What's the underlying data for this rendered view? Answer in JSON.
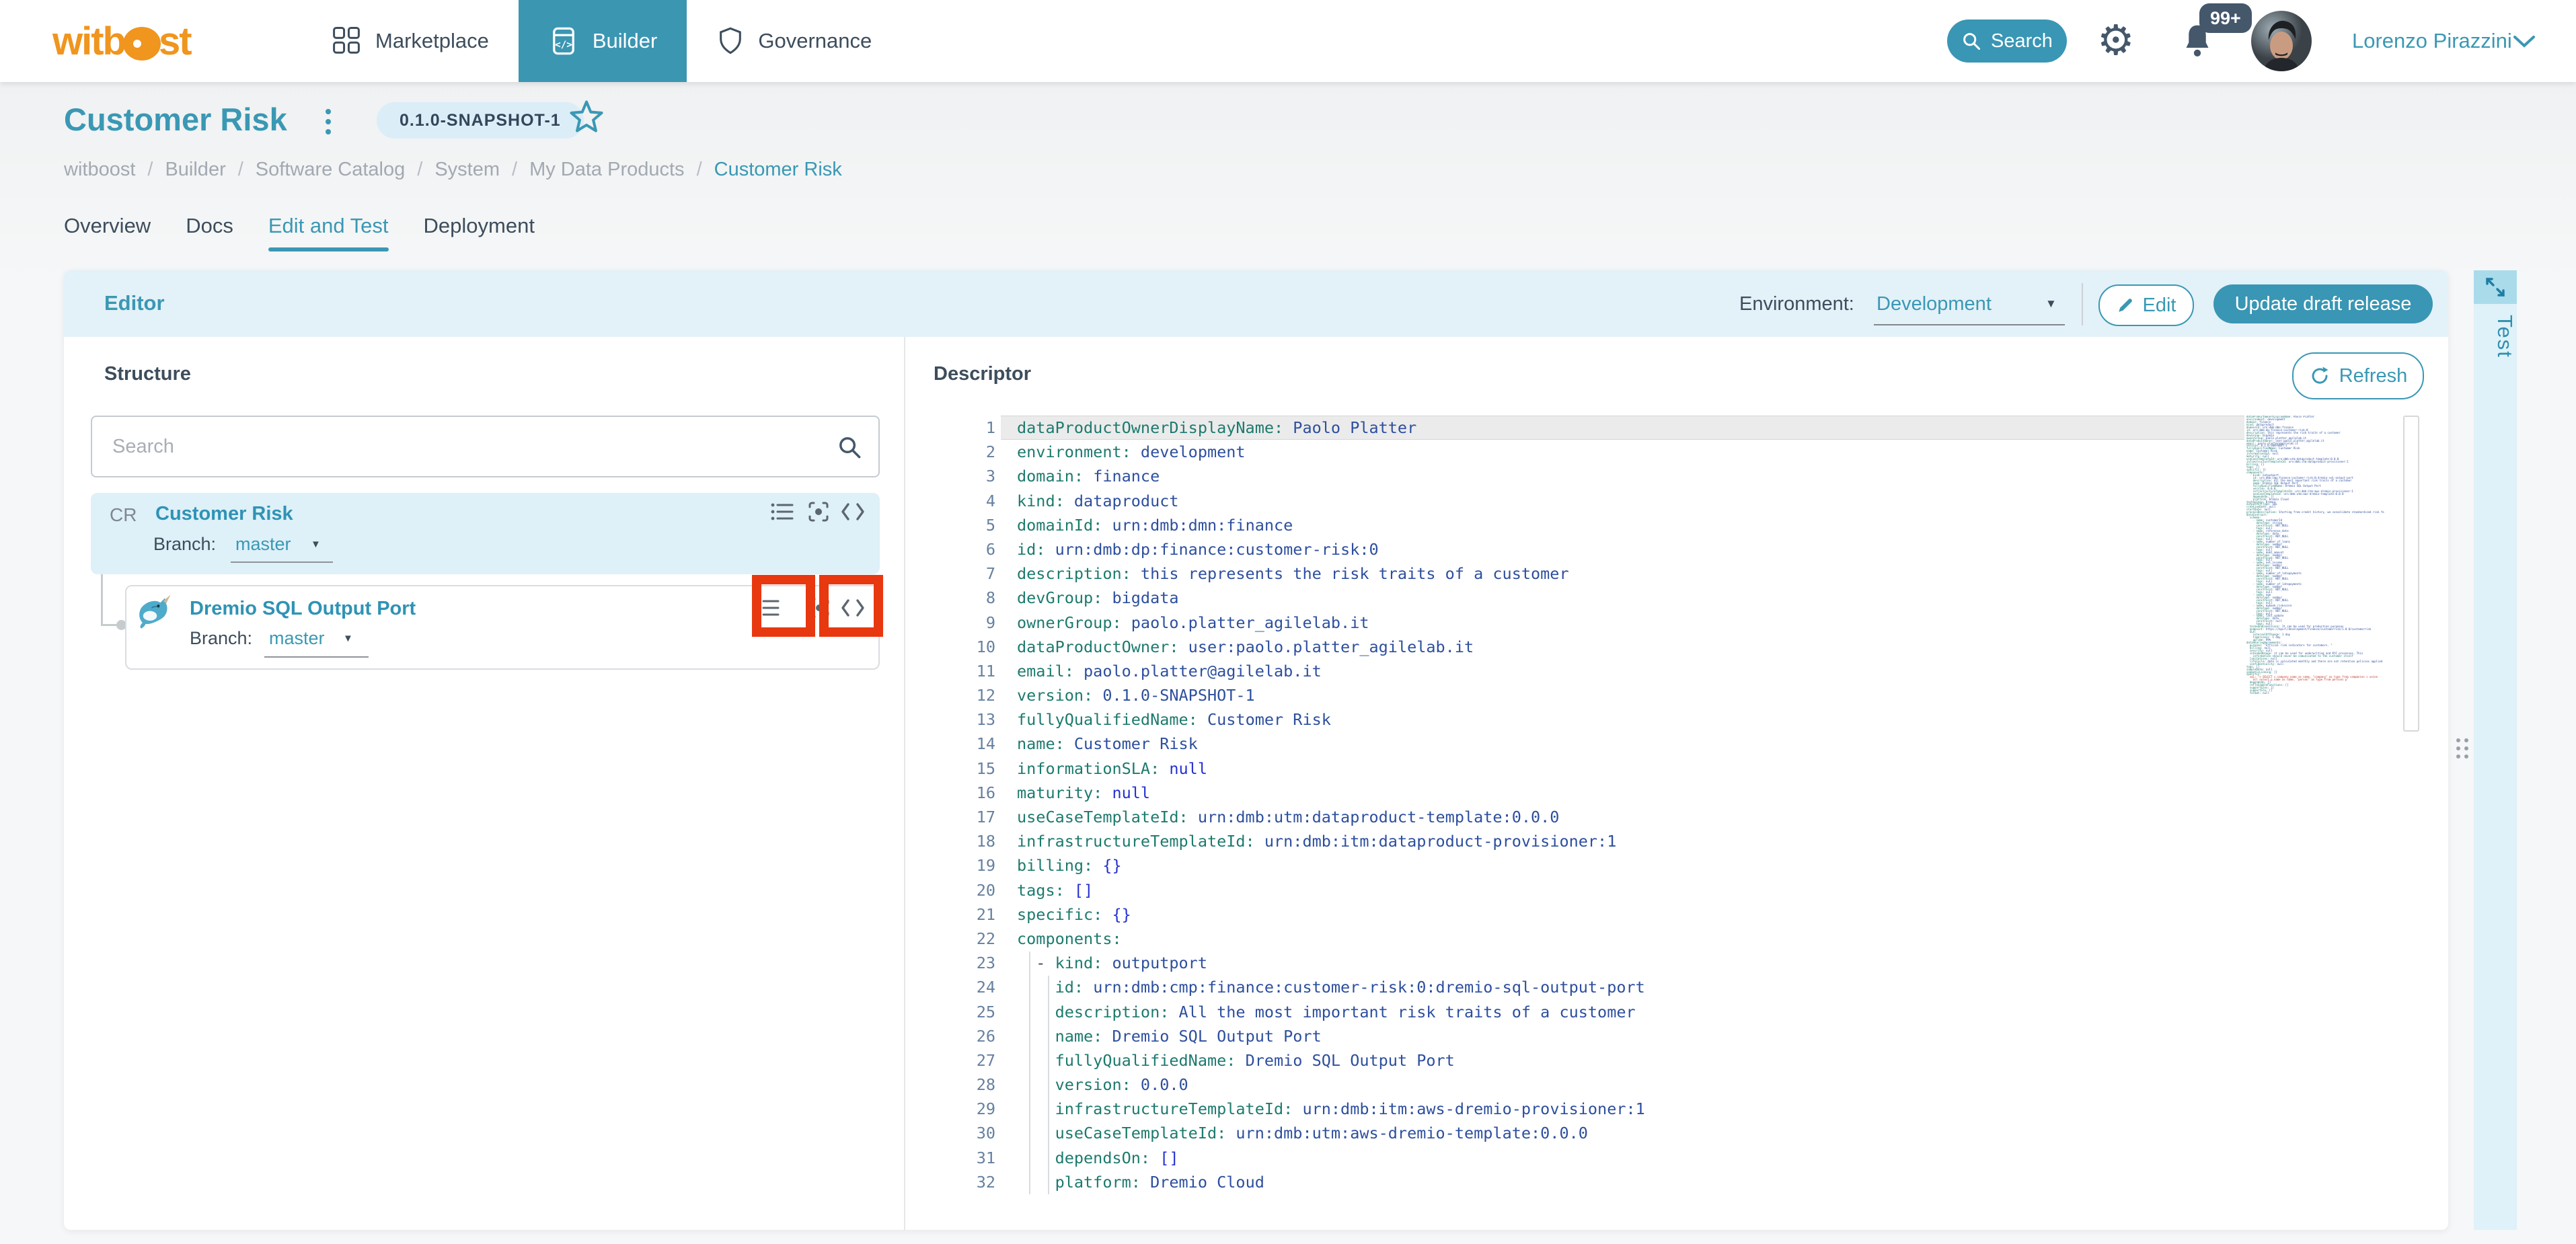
{
  "navbar": {
    "logo": {
      "part1": "witb",
      "part2": "st"
    },
    "items": [
      {
        "label": "Marketplace",
        "active": false
      },
      {
        "label": "Builder",
        "active": true
      },
      {
        "label": "Governance",
        "active": false
      }
    ],
    "search_label": "Search",
    "notifications_badge": "99+",
    "user_name": "Lorenzo Pirazzini"
  },
  "page": {
    "title": "Customer Risk",
    "version_chip": "0.1.0-SNAPSHOT-1",
    "breadcrumb": [
      "witboost",
      "Builder",
      "Software Catalog",
      "System",
      "My Data Products",
      "Customer Risk"
    ],
    "tabs": [
      {
        "label": "Overview",
        "active": false
      },
      {
        "label": "Docs",
        "active": false
      },
      {
        "label": "Edit and Test",
        "active": true
      },
      {
        "label": "Deployment",
        "active": false
      }
    ]
  },
  "editor": {
    "heading": "Editor",
    "environment_label": "Environment:",
    "environment_value": "Development",
    "edit_button": "Edit",
    "update_button": "Update draft release",
    "test_tab": "Test",
    "structure": {
      "heading": "Structure",
      "search_placeholder": "Search",
      "root_node": {
        "badge": "CR",
        "title": "Customer Risk",
        "branch_label": "Branch:",
        "branch": "master"
      },
      "child_node": {
        "title": "Dremio SQL Output Port",
        "branch_label": "Branch:",
        "branch": "master"
      }
    },
    "annotations": {
      "color": "#e8380f",
      "targets": [
        "child-list-icon",
        "child-code-icon"
      ]
    },
    "descriptor": {
      "heading": "Descriptor",
      "refresh_button": "Refresh",
      "yaml": [
        {
          "n": 1,
          "i": 0,
          "k": "dataProductOwnerDisplayName",
          "v": "Paolo Platter",
          "t": "s"
        },
        {
          "n": 2,
          "i": 0,
          "k": "environment",
          "v": "development",
          "t": "s"
        },
        {
          "n": 3,
          "i": 0,
          "k": "domain",
          "v": "finance",
          "t": "s"
        },
        {
          "n": 4,
          "i": 0,
          "k": "kind",
          "v": "dataproduct",
          "t": "s"
        },
        {
          "n": 5,
          "i": 0,
          "k": "domainId",
          "v": "urn:dmb:dmn:finance",
          "t": "s"
        },
        {
          "n": 6,
          "i": 0,
          "k": "id",
          "v": "urn:dmb:dp:finance:customer-risk:0",
          "t": "s"
        },
        {
          "n": 7,
          "i": 0,
          "k": "description",
          "v": "this represents the risk traits of a customer",
          "t": "s"
        },
        {
          "n": 8,
          "i": 0,
          "k": "devGroup",
          "v": "bigdata",
          "t": "s"
        },
        {
          "n": 9,
          "i": 0,
          "k": "ownerGroup",
          "v": "paolo.platter_agilelab.it",
          "t": "s"
        },
        {
          "n": 10,
          "i": 0,
          "k": "dataProductOwner",
          "v": "user:paolo.platter_agilelab.it",
          "t": "s"
        },
        {
          "n": 11,
          "i": 0,
          "k": "email",
          "v": "paolo.platter@agilelab.it",
          "t": "s"
        },
        {
          "n": 12,
          "i": 0,
          "k": "version",
          "v": "0.1.0-SNAPSHOT-1",
          "t": "s"
        },
        {
          "n": 13,
          "i": 0,
          "k": "fullyQualifiedName",
          "v": "Customer Risk",
          "t": "s"
        },
        {
          "n": 14,
          "i": 0,
          "k": "name",
          "v": "Customer Risk",
          "t": "s"
        },
        {
          "n": 15,
          "i": 0,
          "k": "informationSLA",
          "v": "null",
          "t": "x"
        },
        {
          "n": 16,
          "i": 0,
          "k": "maturity",
          "v": "null",
          "t": "x"
        },
        {
          "n": 17,
          "i": 0,
          "k": "useCaseTemplateId",
          "v": "urn:dmb:utm:dataproduct-template:0.0.0",
          "t": "s"
        },
        {
          "n": 18,
          "i": 0,
          "k": "infrastructureTemplateId",
          "v": "urn:dmb:itm:dataproduct-provisioner:1",
          "t": "s"
        },
        {
          "n": 19,
          "i": 0,
          "k": "billing",
          "v": "{}",
          "t": "x"
        },
        {
          "n": 20,
          "i": 0,
          "k": "tags",
          "v": "[]",
          "t": "x"
        },
        {
          "n": 21,
          "i": 0,
          "k": "specific",
          "v": "{}",
          "t": "x"
        },
        {
          "n": 22,
          "i": 0,
          "k": "components",
          "v": null,
          "t": "s"
        },
        {
          "n": 23,
          "i": 2,
          "d": true,
          "k": "kind",
          "v": "outputport",
          "t": "s"
        },
        {
          "n": 24,
          "i": 4,
          "k": "id",
          "v": "urn:dmb:cmp:finance:customer-risk:0:dremio-sql-output-port",
          "t": "s"
        },
        {
          "n": 25,
          "i": 4,
          "k": "description",
          "v": "All the most important risk traits of a customer",
          "t": "s"
        },
        {
          "n": 26,
          "i": 4,
          "k": "name",
          "v": "Dremio SQL Output Port",
          "t": "s"
        },
        {
          "n": 27,
          "i": 4,
          "k": "fullyQualifiedName",
          "v": "Dremio SQL Output Port",
          "t": "s"
        },
        {
          "n": 28,
          "i": 4,
          "k": "version",
          "v": "0.0.0",
          "t": "s"
        },
        {
          "n": 29,
          "i": 4,
          "k": "infrastructureTemplateId",
          "v": "urn:dmb:itm:aws-dremio-provisioner:1",
          "t": "s"
        },
        {
          "n": 30,
          "i": 4,
          "k": "useCaseTemplateId",
          "v": "urn:dmb:utm:aws-dremio-template:0.0.0",
          "t": "s"
        },
        {
          "n": 31,
          "i": 4,
          "k": "dependsOn",
          "v": "[]",
          "t": "x"
        },
        {
          "n": 32,
          "i": 4,
          "k": "platform",
          "v": "Dremio Cloud",
          "t": "s"
        }
      ],
      "minimap_extra": [
        "technology: Dremio",
        "outputPortType: SQL",
        "creationDate: null",
        "startDate: null",
        "processDescription: Starting from credit history, we consolidate standardized risk features",
        "dataContract:",
        "  schema:",
        "    - name: customerId",
        "      dataType: string",
        "      constraint: NOT_NULL",
        "      tags: null",
        "    - name: reference_date",
        "      dataType: date",
        "      constraint: NOT_NULL",
        "      tags: null",
        "    - name: number_of_loans",
        "      dataType: number",
        "      constraint: NOT_NULL",
        "      tags: null",
        "    - name: debt_amount",
        "      dataType: number",
        "      constraint: NOT_NULL",
        "      tags: null",
        "    - name: net_income",
        "      dataType: number",
        "      constraint: NOT_NULL",
        "      tags: null",
        "    - name: number_of_latepayments",
        "      dataType: number",
        "      constraint: NOT_NULL",
        "      tags: null",
        "    - name: number_of_latepayments",
        "      dataType: number",
        "      constraint: NOT_NULL",
        "      tags: null",
        "    - name: age",
        "      dataType: number",
        "      constraint: NOT_NULL",
        "      tags: null",
        "    - name: mybank_riskscore",
        "      dataType: number",
        "      constraint: NOT_NULL",
        "      tags: null",
        "    - name: last_update",
        "      dataType: date",
        "      constraint: null",
        "      tags: null",
        "  termsAndConditions: It can be used for production purposes",
        "  endpoint: https://myurl/development/finance/customerrisk/1.0.0/customerrisk",
        "  SLA:",
        "    intervalOfChange: 1 day",
        "    timeliness: 1 day",
        "    upTime: 99%",
        "dataSharingAgreements:",
        "  purpose: \"official risk indicators for customers. \"",
        "  billing: null",
        "  security: null",
        "  intendedUsage: it can be used for underwriting and KYC processes. This",
        "    information should never be comunicated to the customer itself",
        "  limitations: null",
        "  lifeCycle: data is calculated monthly and there are not retention policies applied",
        "  confidentiality: null",
        "tags: []",
        "sampleData: null",
        "semanticLinking: []",
        "specific:",
        "  sql: \"> SELECT c.company_name as name, \"company\" as type from companies c union",
        "    all select p.name as name, \"person\" as type from persons p\"",
        "  dependsOn: []",
        "  refToSimbleFunctions: []",
        "  supportSlos: []",
        "  supportSla: []",
        "  format: null"
      ]
    }
  },
  "colors": {
    "accent": "#3a98b4",
    "nav_active_bg": "#3b96b2",
    "brand_orange": "#f0951e",
    "yaml_key": "#1d7a6e",
    "yaml_value": "#2d4f9e",
    "yaml_special": "#2531d0",
    "annotation_red": "#e8380f",
    "slate": "#44576b"
  }
}
